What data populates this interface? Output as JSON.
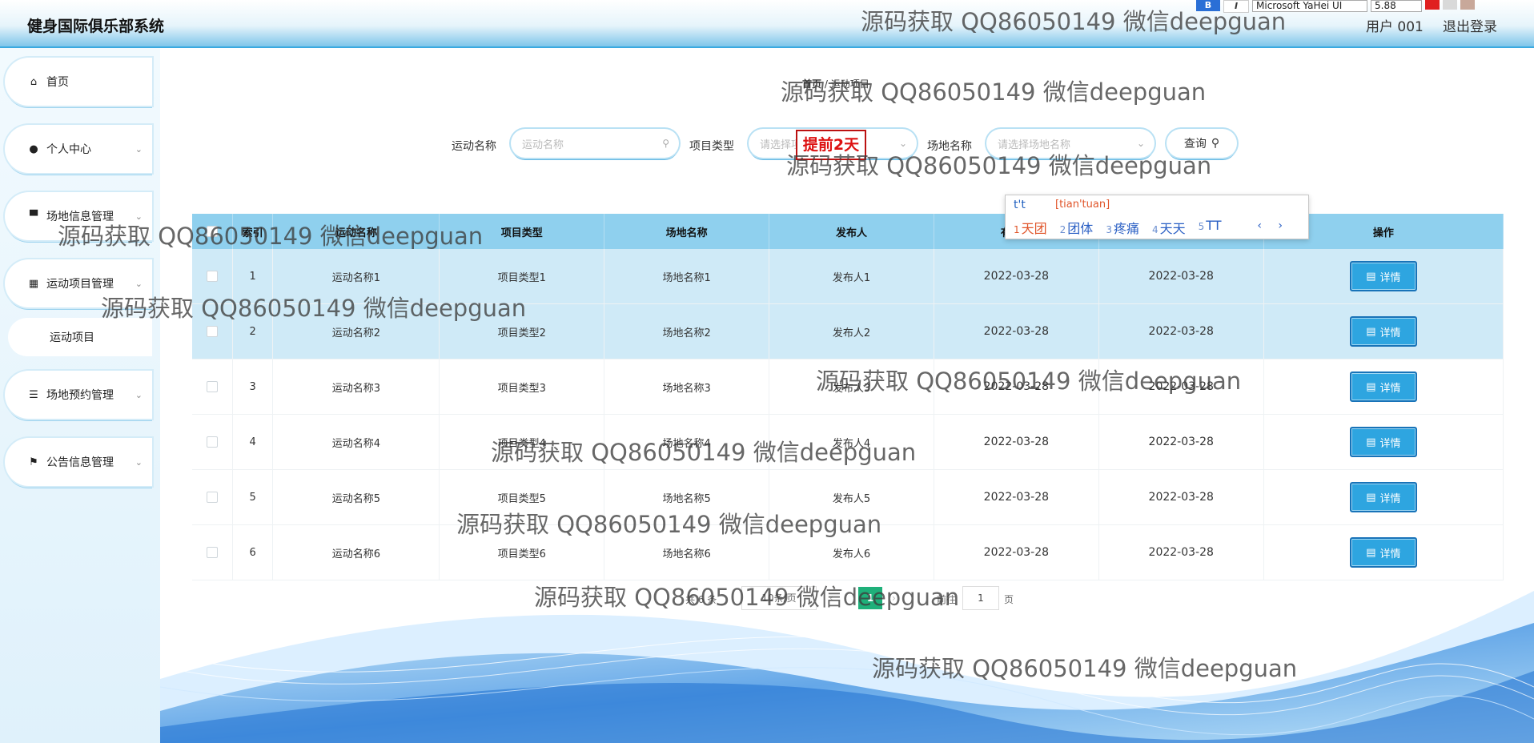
{
  "header": {
    "title": "健身国际俱乐部系统",
    "user": "用户 001",
    "logout": "退出登录"
  },
  "toolbar": {
    "bold": "B",
    "italic": "I",
    "font": "Microsoft YaHei UI",
    "size": "5.88"
  },
  "sidebar": {
    "items": [
      {
        "label": "首页",
        "icon": "home-icon"
      },
      {
        "label": "个人中心",
        "icon": "user-icon"
      },
      {
        "label": "场地信息管理",
        "icon": "monitor-icon"
      },
      {
        "label": "运动项目管理",
        "icon": "grid-icon"
      },
      {
        "label": "场地预约管理",
        "icon": "sliders-icon"
      },
      {
        "label": "公告信息管理",
        "icon": "flag-icon"
      }
    ],
    "sub_item": "运动项目"
  },
  "breadcrumb": {
    "home": "首页",
    "sep": "/",
    "current": "运动项目"
  },
  "search": {
    "name_label": "运动名称",
    "name_placeholder": "运动名称",
    "type_label": "项目类型",
    "type_placeholder": "请选择项目类型",
    "site_label": "场地名称",
    "site_placeholder": "请选择场地名称",
    "query_button": "查询"
  },
  "stamp": "提前2天",
  "ime": {
    "typed": "t't",
    "pinyin": "[tian'tuan]",
    "candidates": [
      {
        "n": "1",
        "text": "天团"
      },
      {
        "n": "2",
        "text": "团体"
      },
      {
        "n": "3",
        "text": "疼痛"
      },
      {
        "n": "4",
        "text": "天天"
      },
      {
        "n": "5",
        "text": "TT"
      }
    ],
    "nav": "‹ ›"
  },
  "table": {
    "headers": [
      "索引",
      "运动名称",
      "项目类型",
      "场地名称",
      "发布人",
      "有效期",
      "",
      "操作"
    ],
    "rows": [
      {
        "idx": "1",
        "name": "运动名称1",
        "type": "项目类型1",
        "site": "场地名称1",
        "publisher": "发布人1",
        "d1": "2022-03-28",
        "d2": "2022-03-28",
        "selected": true
      },
      {
        "idx": "2",
        "name": "运动名称2",
        "type": "项目类型2",
        "site": "场地名称2",
        "publisher": "发布人2",
        "d1": "2022-03-28",
        "d2": "2022-03-28",
        "selected": true
      },
      {
        "idx": "3",
        "name": "运动名称3",
        "type": "项目类型3",
        "site": "场地名称3",
        "publisher": "发布人3",
        "d1": "2022-03-28",
        "d2": "2022-03-28",
        "selected": false
      },
      {
        "idx": "4",
        "name": "运动名称4",
        "type": "项目类型4",
        "site": "场地名称4",
        "publisher": "发布人4",
        "d1": "2022-03-28",
        "d2": "2022-03-28",
        "selected": false
      },
      {
        "idx": "5",
        "name": "运动名称5",
        "type": "项目类型5",
        "site": "场地名称5",
        "publisher": "发布人5",
        "d1": "2022-03-28",
        "d2": "2022-03-28",
        "selected": false
      },
      {
        "idx": "6",
        "name": "运动名称6",
        "type": "项目类型6",
        "site": "场地名称6",
        "publisher": "发布人6",
        "d1": "2022-03-28",
        "d2": "2022-03-28",
        "selected": false
      }
    ],
    "detail_label": "详情"
  },
  "pager": {
    "total": "共 6 条",
    "page_size": "10条/页",
    "current": "1",
    "goto": "前往",
    "goto_value": "1",
    "unit": "页"
  },
  "watermark": "源码获取 QQ86050149 微信deepguan",
  "colors": {
    "accent": "#2ea5e0",
    "header_bg": "#8fd0ee",
    "pager_active": "#1fb07a",
    "stamp": "#d11111"
  }
}
